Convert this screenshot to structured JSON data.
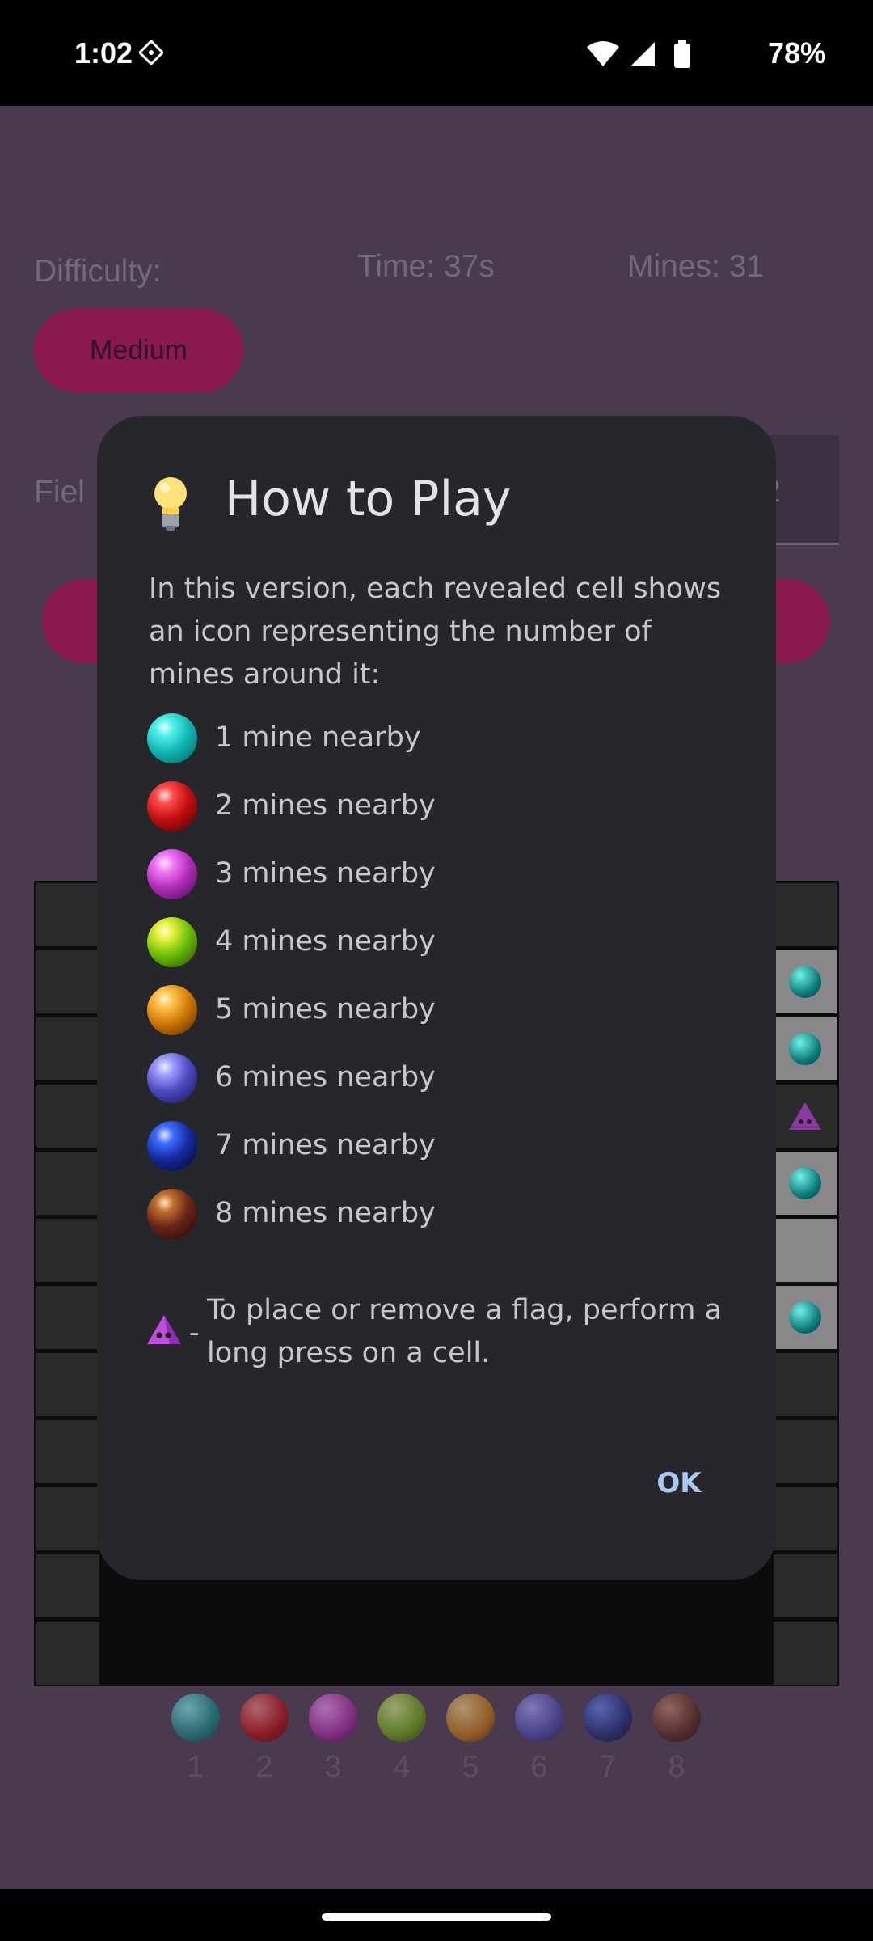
{
  "status": {
    "time": "1:02",
    "battery": "78%"
  },
  "background": {
    "difficulty_label": "Difficulty:",
    "time_label": "Time: 37s",
    "mines_label": "Mines: 31",
    "difficulty_button": "Medium",
    "field_label_partial": "Fiel",
    "field_value_partial": "2",
    "legend": [
      "1",
      "2",
      "3",
      "4",
      "5",
      "6",
      "7",
      "8"
    ]
  },
  "dialog": {
    "title": "How to Play",
    "intro": "In this version, each revealed cell shows an icon representing the number of mines around it:",
    "items": [
      {
        "label": "1 mine nearby",
        "color": "#19c3c1"
      },
      {
        "label": "2 mines nearby",
        "color": "#d01414"
      },
      {
        "label": "3 mines nearby",
        "color": "#c23cc8"
      },
      {
        "label": "4 mines nearby",
        "color": "#7ac60a"
      },
      {
        "label": "5 mines nearby",
        "color": "#e18a0e"
      },
      {
        "label": "6 mines nearby",
        "color": "#5a56c8"
      },
      {
        "label": "7 mines nearby",
        "color": "#1c2a8c"
      },
      {
        "label": "8 mines nearby",
        "color": "#6a2a1e"
      }
    ],
    "flag_dash": "-",
    "flag_text": "To place or remove a flag, perform a long press on a cell.",
    "ok_label": "OK"
  },
  "colors": {
    "dialog_bg": "#25272b",
    "accent": "#a8c8f0",
    "app_bg": "#4a3a4f"
  }
}
